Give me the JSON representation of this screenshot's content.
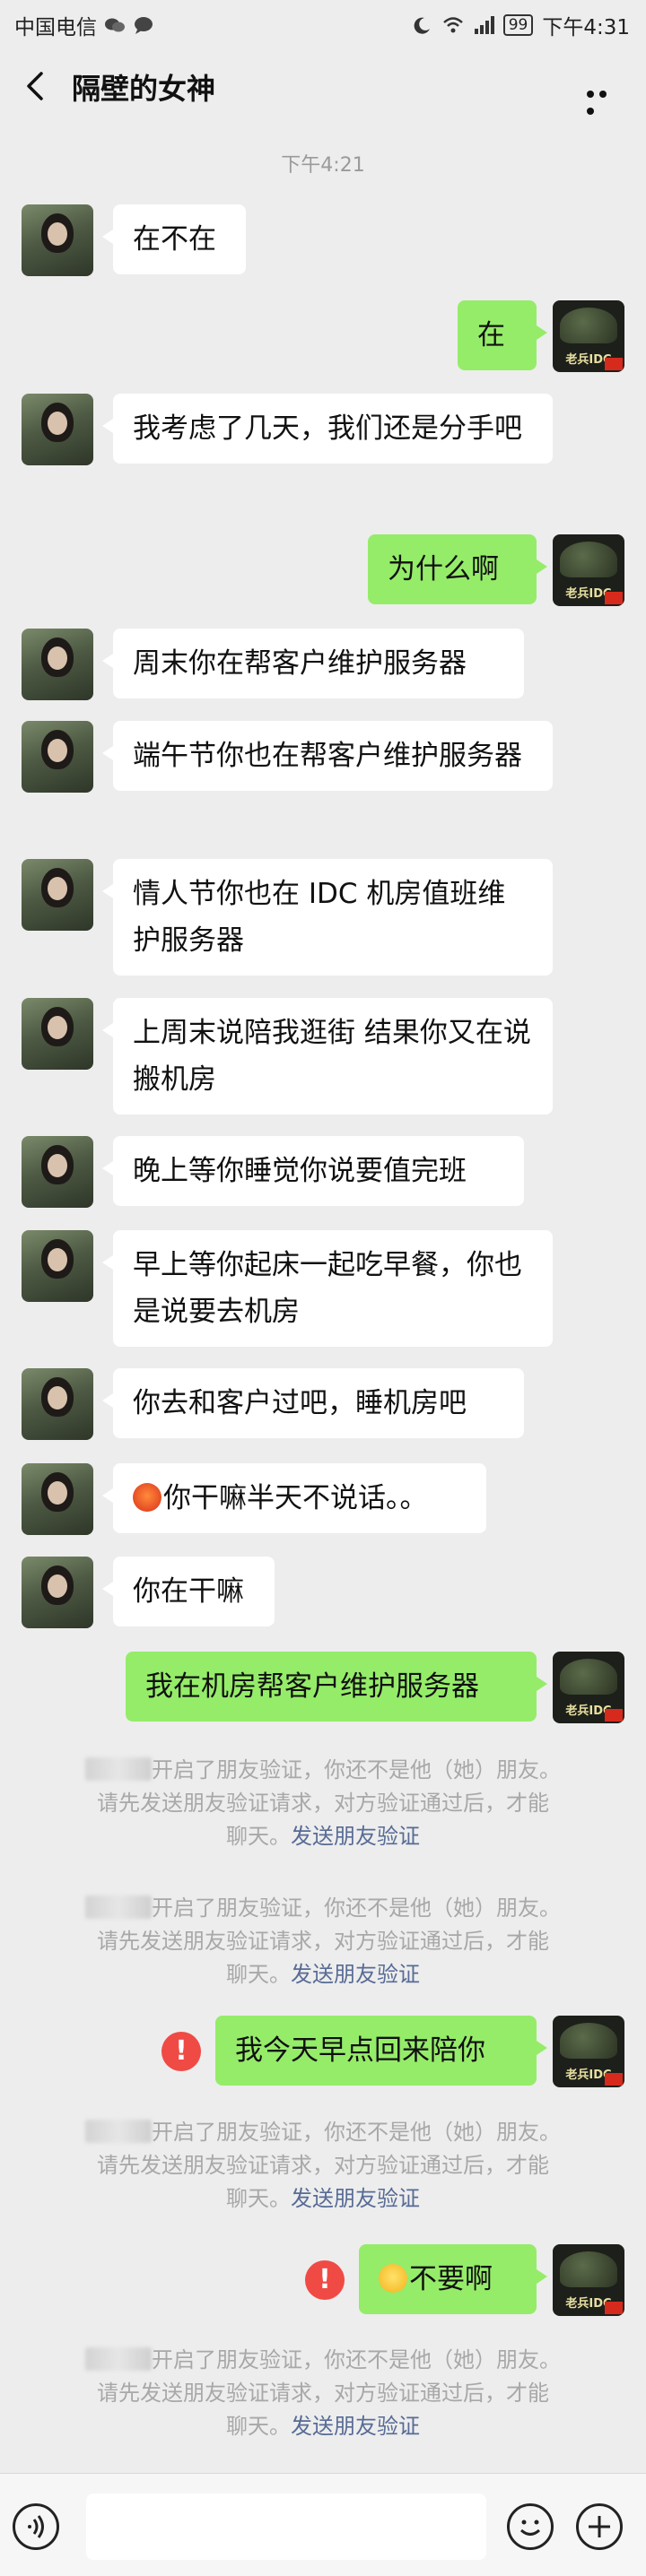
{
  "status_bar": {
    "carrier": "中国电信",
    "battery": "99",
    "time": "下午4:31"
  },
  "header": {
    "title": "隔壁的女神"
  },
  "conversation": {
    "timestamp": "下午4:21",
    "messages": [
      {
        "from": "contact",
        "text": "在不在"
      },
      {
        "from": "me",
        "text": "在"
      },
      {
        "from": "contact",
        "text": "我考虑了几天，我们还是分手吧"
      },
      {
        "from": "me",
        "text": "为什么啊"
      },
      {
        "from": "contact",
        "text": "周末你在帮客户维护服务器"
      },
      {
        "from": "contact",
        "text": "端午节你也在帮客户维护服务器"
      },
      {
        "from": "contact",
        "text": "情人节你也在 IDC 机房值班维护服务器"
      },
      {
        "from": "contact",
        "text": "上周末说陪我逛街 结果你又在说搬机房"
      },
      {
        "from": "contact",
        "text": "晚上等你睡觉你说要值完班"
      },
      {
        "from": "contact",
        "text": "早上等你起床一起吃早餐，你也是说要去机房"
      },
      {
        "from": "contact",
        "text": "你去和客户过吧，睡机房吧"
      },
      {
        "from": "contact",
        "text": "你干嘛半天不说话。。",
        "emoji": "angry-face"
      },
      {
        "from": "contact",
        "text": "你在干嘛"
      },
      {
        "from": "me",
        "text": "我在机房帮客户维护服务器"
      },
      {
        "from": "me",
        "text": "我今天早点回来陪你",
        "failed": true
      },
      {
        "from": "me",
        "text": "不要啊",
        "failed": true,
        "emoji": "crying-face"
      }
    ],
    "system_notice": {
      "line1": "开启了朋友验证，你还不是他（她）朋友。",
      "line2": "请先发送朋友验证请求，对方验证通过后，才能",
      "line3": "聊天。",
      "link": "发送朋友验证"
    }
  },
  "my_avatar_text": "老兵IDC",
  "input_bar": {
    "placeholder": ""
  }
}
